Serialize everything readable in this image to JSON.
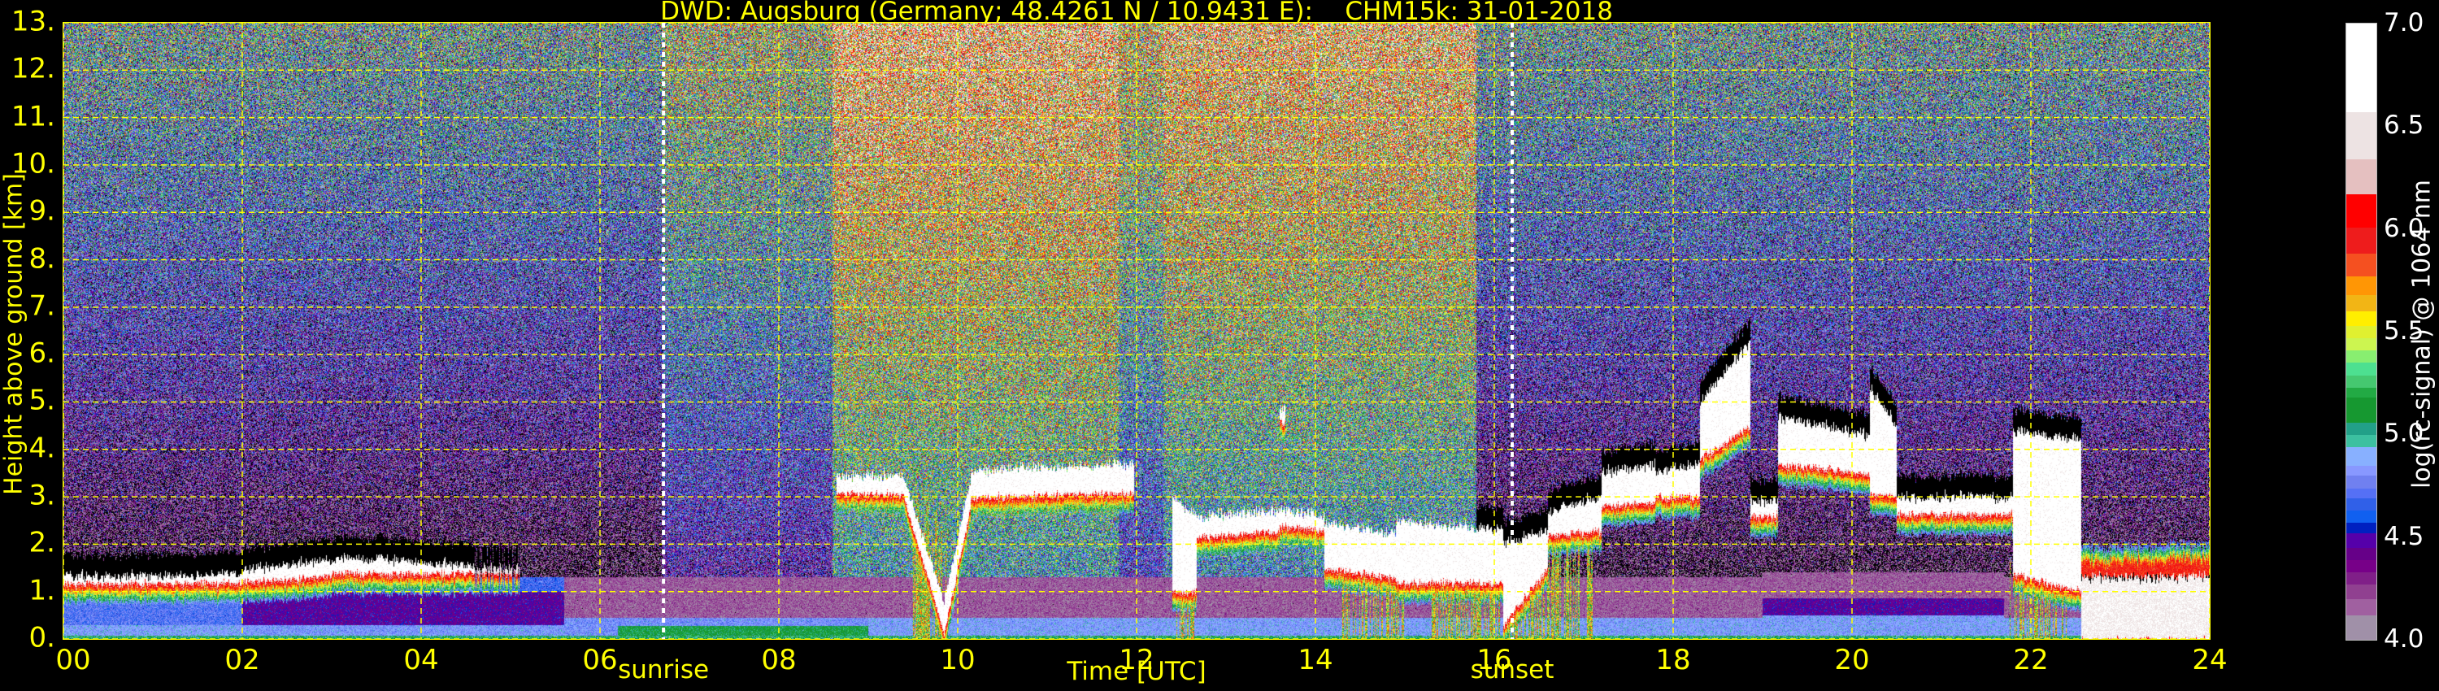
{
  "chart_data": {
    "type": "heatmap",
    "title": "DWD: Augsburg (Germany; 48.4261 N / 10.9431 E):    CHM15k: 31-01-2018",
    "xlabel": "Time [UTC]",
    "ylabel": "Height above ground [km]",
    "xlim": [
      0,
      24
    ],
    "ylim": [
      0,
      13
    ],
    "grid": true,
    "grid_color": "#ffff00",
    "axis_color": "#ffff00",
    "xticks": [
      {
        "value": 0,
        "label": "00"
      },
      {
        "value": 2,
        "label": "02"
      },
      {
        "value": 4,
        "label": "04"
      },
      {
        "value": 6,
        "label": "06"
      },
      {
        "value": 8,
        "label": "08"
      },
      {
        "value": 10,
        "label": "10"
      },
      {
        "value": 12,
        "label": "12"
      },
      {
        "value": 14,
        "label": "14"
      },
      {
        "value": 16,
        "label": "16"
      },
      {
        "value": 18,
        "label": "18"
      },
      {
        "value": 20,
        "label": "20"
      },
      {
        "value": 22,
        "label": "22"
      },
      {
        "value": 24,
        "label": "24"
      }
    ],
    "yticks": [
      {
        "value": 0,
        "label": "0."
      },
      {
        "value": 1,
        "label": "1."
      },
      {
        "value": 2,
        "label": "2."
      },
      {
        "value": 3,
        "label": "3."
      },
      {
        "value": 4,
        "label": "4."
      },
      {
        "value": 5,
        "label": "5."
      },
      {
        "value": 6,
        "label": "6."
      },
      {
        "value": 7,
        "label": "7."
      },
      {
        "value": 8,
        "label": "8."
      },
      {
        "value": 9,
        "label": "9."
      },
      {
        "value": 10,
        "label": "10."
      },
      {
        "value": 11,
        "label": "11."
      },
      {
        "value": 12,
        "label": "12."
      },
      {
        "value": 13,
        "label": "13."
      }
    ],
    "annotations": [
      {
        "label": "sunrise",
        "time": 6.71
      },
      {
        "label": "sunset",
        "time": 16.2
      }
    ],
    "colorbar": {
      "label": "log(rc-signal) @ 1064 nm",
      "range": [
        4.0,
        7.0
      ],
      "ticks": [
        {
          "value": 4.0,
          "label": "4.0"
        },
        {
          "value": 4.5,
          "label": "4.5"
        },
        {
          "value": 5.0,
          "label": "5.0"
        },
        {
          "value": 5.5,
          "label": "5.5"
        },
        {
          "value": 6.0,
          "label": "6.0"
        },
        {
          "value": 6.5,
          "label": "6.5"
        },
        {
          "value": 7.0,
          "label": "7.0"
        }
      ],
      "levels": [
        {
          "from": 4.0,
          "color": "#a090a8"
        },
        {
          "from": 4.12,
          "color": "#a060a0"
        },
        {
          "from": 4.2,
          "color": "#904090"
        },
        {
          "from": 4.27,
          "color": "#801f88"
        },
        {
          "from": 4.33,
          "color": "#770088"
        },
        {
          "from": 4.39,
          "color": "#660088"
        },
        {
          "from": 4.45,
          "color": "#5500aa"
        },
        {
          "from": 4.52,
          "color": "#0020c0"
        },
        {
          "from": 4.57,
          "color": "#1060f0"
        },
        {
          "from": 4.63,
          "color": "#3060e8"
        },
        {
          "from": 4.69,
          "color": "#5570f5"
        },
        {
          "from": 4.74,
          "color": "#7080f0"
        },
        {
          "from": 4.8,
          "color": "#8898ff"
        },
        {
          "from": 4.85,
          "color": "#88b0ff"
        },
        {
          "from": 4.94,
          "color": "#3cc0a0"
        },
        {
          "from": 5.0,
          "color": "#22a088"
        },
        {
          "from": 5.06,
          "color": "#169830"
        },
        {
          "from": 5.18,
          "color": "#22aa44"
        },
        {
          "from": 5.23,
          "color": "#45c870"
        },
        {
          "from": 5.29,
          "color": "#4de090"
        },
        {
          "from": 5.35,
          "color": "#88ee70"
        },
        {
          "from": 5.41,
          "color": "#ccf550"
        },
        {
          "from": 5.47,
          "color": "#e0f030"
        },
        {
          "from": 5.53,
          "color": "#ffee00"
        },
        {
          "from": 5.6,
          "color": "#f2b515"
        },
        {
          "from": 5.68,
          "color": "#ff9605"
        },
        {
          "from": 5.77,
          "color": "#f55020"
        },
        {
          "from": 5.88,
          "color": "#ee1c1c"
        },
        {
          "from": 6.01,
          "color": "#ff0000"
        },
        {
          "from": 6.17,
          "color": "#e5c0c0"
        },
        {
          "from": 6.34,
          "color": "#ede3e3"
        },
        {
          "from": 6.57,
          "color": "#ffffff"
        }
      ]
    },
    "background_segments": [
      {
        "t": [
          0,
          6.7
        ],
        "daylight": 0.0
      },
      {
        "t": [
          6.7,
          8.6
        ],
        "daylight": 0.35
      },
      {
        "t": [
          8.6,
          11.8
        ],
        "daylight": 1.0
      },
      {
        "t": [
          11.8,
          12.3
        ],
        "daylight": 0.55
      },
      {
        "t": [
          12.3,
          15.8
        ],
        "daylight": 0.9
      },
      {
        "t": [
          15.8,
          24
        ],
        "daylight": 0.0
      }
    ],
    "boundary_layer": [
      {
        "t": [
          0,
          2
        ],
        "layers": [
          {
            "h": [
              0,
              0.3
            ],
            "v": 4.85
          },
          {
            "h": [
              0.3,
              1.1
            ],
            "v": 4.72
          }
        ]
      },
      {
        "t": [
          2,
          5.6
        ],
        "layers": [
          {
            "h": [
              0,
              0.3
            ],
            "v": 4.82
          },
          {
            "h": [
              0.3,
              1.0
            ],
            "v": 4.45
          },
          {
            "h": [
              1.0,
              1.3
            ],
            "v": 4.68
          }
        ]
      },
      {
        "t": [
          5.6,
          6.2
        ],
        "layers": [
          {
            "h": [
              0,
              0.45
            ],
            "v": 4.8
          },
          {
            "h": [
              0.45,
              1.3
            ],
            "v": 4.18
          }
        ]
      },
      {
        "t": [
          6.2,
          9
        ],
        "layers": [
          {
            "h": [
              0,
              0.28
            ],
            "v": 5.12
          },
          {
            "h": [
              0.28,
              0.45
            ],
            "v": 4.8
          },
          {
            "h": [
              0.45,
              1.3
            ],
            "v": 4.18
          }
        ]
      },
      {
        "t": [
          9,
          19
        ],
        "layers": [
          {
            "h": [
              0,
              0.45
            ],
            "v": 4.84
          },
          {
            "h": [
              0.45,
              1.3
            ],
            "v": 4.18
          }
        ]
      },
      {
        "t": [
          19,
          21.7
        ],
        "layers": [
          {
            "h": [
              0,
              0.5
            ],
            "v": 4.84
          },
          {
            "h": [
              0.5,
              0.85
            ],
            "v": 4.45
          },
          {
            "h": [
              0.85,
              1.4
            ],
            "v": 4.18
          }
        ]
      },
      {
        "t": [
          21.7,
          24
        ],
        "layers": [
          {
            "h": [
              0,
              0.45
            ],
            "v": 4.84
          },
          {
            "h": [
              0.45,
              1.3
            ],
            "v": 4.18
          }
        ]
      }
    ],
    "cloud_layers": [
      {
        "t": [
          0,
          2.0
        ],
        "base": [
          1.18,
          1.2
        ],
        "top": [
          1.32,
          1.38
        ],
        "v": 6.8
      },
      {
        "t": [
          2.0,
          3.0
        ],
        "base": [
          1.2,
          1.35
        ],
        "top": [
          1.45,
          1.65
        ],
        "v": 6.8
      },
      {
        "t": [
          3.0,
          4.0
        ],
        "base": [
          1.4,
          1.4
        ],
        "top": [
          1.7,
          1.65
        ],
        "v": 6.8
      },
      {
        "t": [
          4.0,
          4.6
        ],
        "base": [
          1.4,
          1.4
        ],
        "top": [
          1.6,
          1.55
        ],
        "v": 6.8
      },
      {
        "t": [
          4.6,
          5.1
        ],
        "base": [
          1.4,
          1.4
        ],
        "top": [
          1.5,
          1.5
        ],
        "v": 6.6
      },
      {
        "t": [
          8.65,
          9.4
        ],
        "base": [
          3.1,
          3.05
        ],
        "top": [
          3.45,
          3.45
        ],
        "v": 6.8
      },
      {
        "t": [
          9.4,
          9.85
        ],
        "base": [
          3.0,
          0.15
        ],
        "top": [
          3.4,
          0.8
        ],
        "v": 6.8
      },
      {
        "t": [
          9.85,
          10.15
        ],
        "base": [
          0.15,
          2.8
        ],
        "top": [
          0.8,
          3.4
        ],
        "v": 6.8
      },
      {
        "t": [
          10.15,
          11.97
        ],
        "base": [
          3.0,
          3.1
        ],
        "top": [
          3.55,
          3.7
        ],
        "v": 6.8
      },
      {
        "t": [
          12.4,
          12.67
        ],
        "base": [
          1.0,
          1.0
        ],
        "top": [
          3.0,
          2.6
        ],
        "v": 6.8
      },
      {
        "t": [
          12.67,
          13.6
        ],
        "base": [
          2.15,
          2.3
        ],
        "top": [
          2.6,
          2.7
        ],
        "v": 6.8
      },
      {
        "t": [
          13.6,
          13.66
        ],
        "base": [
          4.6,
          4.6
        ],
        "top": [
          4.9,
          4.9
        ],
        "v": 6.8
      },
      {
        "t": [
          13.6,
          14.1
        ],
        "base": [
          2.4,
          2.3
        ],
        "top": [
          2.75,
          2.6
        ],
        "v": 6.8
      },
      {
        "t": [
          14.1,
          14.9
        ],
        "base": [
          1.5,
          1.3
        ],
        "top": [
          2.45,
          2.2
        ],
        "v": 6.8
      },
      {
        "t": [
          14.9,
          16.1
        ],
        "base": [
          1.2,
          1.2
        ],
        "top": [
          2.5,
          2.3
        ],
        "v": 6.8
      },
      {
        "t": [
          16.1,
          16.6
        ],
        "base": [
          0.3,
          1.5
        ],
        "top": [
          2.0,
          2.3
        ],
        "v": 6.8
      },
      {
        "t": [
          16.6,
          17.2
        ],
        "base": [
          2.2,
          2.3
        ],
        "top": [
          2.7,
          3.0
        ],
        "v": 6.8
      },
      {
        "t": [
          17.2,
          17.8
        ],
        "base": [
          2.8,
          2.9
        ],
        "top": [
          3.5,
          3.7
        ],
        "v": 6.8
      },
      {
        "t": [
          17.8,
          18.3
        ],
        "base": [
          3.0,
          3.0
        ],
        "top": [
          3.5,
          3.7
        ],
        "v": 6.8
      },
      {
        "t": [
          18.3,
          18.86
        ],
        "base": [
          3.8,
          4.5
        ],
        "top": [
          5.0,
          6.3
        ],
        "v": 6.8
      },
      {
        "t": [
          18.86,
          19.17
        ],
        "base": [
          2.6,
          2.6
        ],
        "top": [
          2.9,
          2.9
        ],
        "v": 6.8
      },
      {
        "t": [
          19.17,
          20.2
        ],
        "base": [
          3.7,
          3.5
        ],
        "top": [
          4.7,
          4.3
        ],
        "v": 6.8
      },
      {
        "t": [
          20.2,
          20.5
        ],
        "base": [
          3.1,
          3.0
        ],
        "top": [
          5.3,
          4.5
        ],
        "v": 6.8
      },
      {
        "t": [
          20.5,
          21.8
        ],
        "base": [
          2.65,
          2.65
        ],
        "top": [
          3.0,
          3.0
        ],
        "v": 6.8
      },
      {
        "t": [
          21.8,
          22.56
        ],
        "base": [
          1.4,
          1.0
        ],
        "top": [
          4.4,
          4.2
        ],
        "v": 6.8
      },
      {
        "t": [
          22.56,
          24
        ],
        "base": [
          1.3,
          1.3
        ],
        "top": [
          1.55,
          1.6
        ],
        "v": 6.05,
        "fringe": "above"
      },
      {
        "t": [
          22.56,
          24
        ],
        "base": [
          0.0,
          0.0
        ],
        "top": [
          1.3,
          1.3
        ],
        "v": 6.7
      }
    ],
    "precipitation_streaks": [
      {
        "t": [
          9.5,
          9.9
        ],
        "top": 3.0
      },
      {
        "t": [
          12.45,
          12.67
        ],
        "top": 1.2
      },
      {
        "t": [
          14.3,
          15.0
        ],
        "top": 1.6
      },
      {
        "t": [
          15.3,
          16.6
        ],
        "top": 1.4
      },
      {
        "t": [
          16.6,
          17.1
        ],
        "top": 2.2
      },
      {
        "t": [
          21.75,
          22.4
        ],
        "top": 1.5
      }
    ]
  }
}
